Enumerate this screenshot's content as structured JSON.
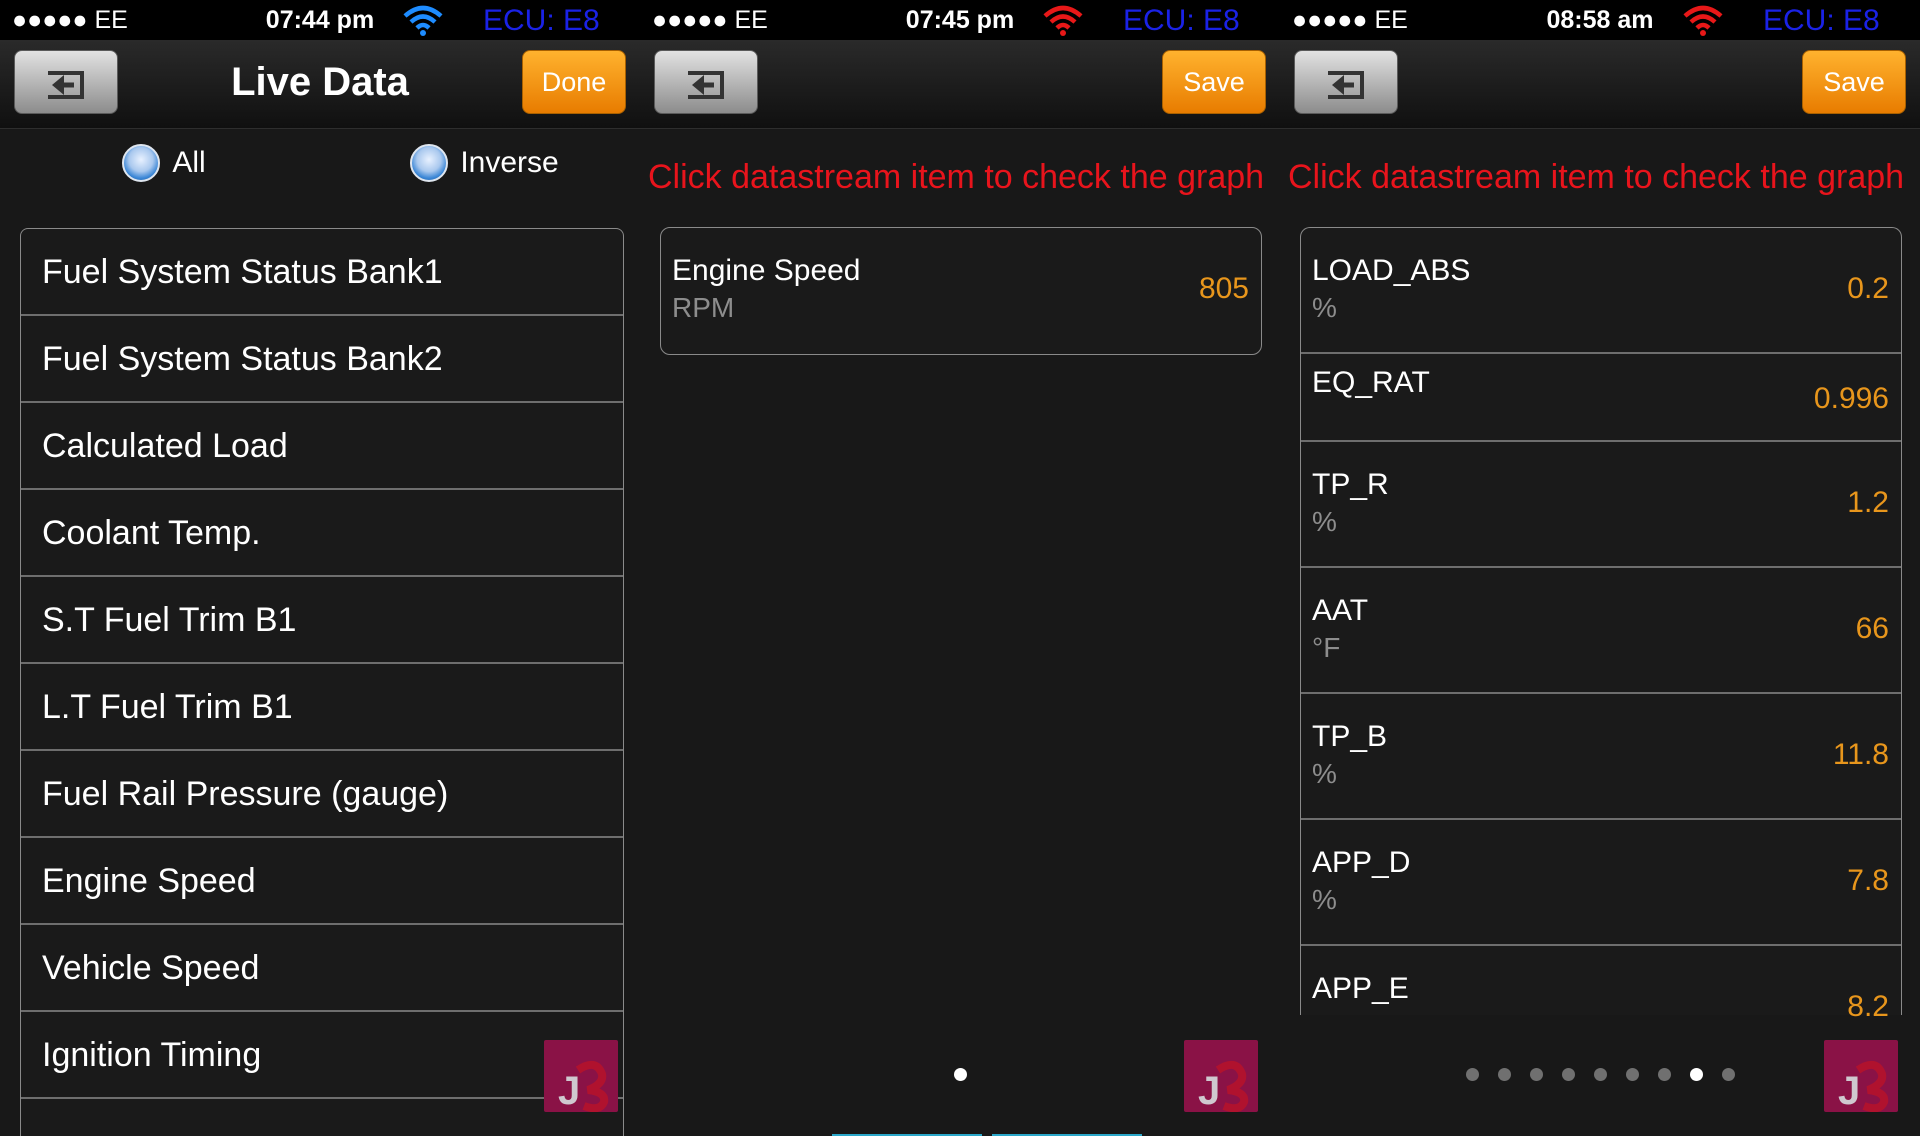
{
  "panels": [
    {
      "status": {
        "carrier": "●●●●● EE",
        "time": "07:44 pm",
        "ecu": "ECU: E8",
        "wifi_color": "#1e8cff"
      },
      "nav": {
        "title": "Live Data",
        "button": "Done"
      },
      "toggles": {
        "all": "All",
        "inverse": "Inverse"
      },
      "items": [
        "Fuel System Status Bank1",
        "Fuel System Status Bank2",
        "Calculated Load",
        "Coolant Temp.",
        "S.T Fuel Trim B1",
        "L.T Fuel Trim B1",
        "Fuel Rail Pressure (gauge)",
        "Engine Speed",
        "Vehicle Speed",
        "Ignition Timing"
      ]
    },
    {
      "status": {
        "carrier": "●●●●● EE",
        "time": "07:45 pm",
        "ecu": "ECU: E8",
        "wifi_color": "#e81818"
      },
      "nav": {
        "button": "Save"
      },
      "hint": "Click datastream item to check the graph",
      "rows": [
        {
          "name": "Engine Speed",
          "unit": "RPM",
          "value": "805"
        }
      ]
    },
    {
      "status": {
        "carrier": "●●●●● EE",
        "time": "08:58 am",
        "ecu": "ECU: E8",
        "wifi_color": "#e81818"
      },
      "nav": {
        "button": "Save"
      },
      "hint": "Click datastream item to check the graph",
      "rows": [
        {
          "name": "LOAD_ABS",
          "unit": "%",
          "value": "0.2"
        },
        {
          "name": "EQ_RAT",
          "unit": "",
          "value": "0.996"
        },
        {
          "name": "TP_R",
          "unit": "%",
          "value": "1.2"
        },
        {
          "name": "AAT",
          "unit": "°F",
          "value": "66"
        },
        {
          "name": "TP_B",
          "unit": "%",
          "value": "11.8"
        },
        {
          "name": "APP_D",
          "unit": "%",
          "value": "7.8"
        },
        {
          "name": "APP_E",
          "unit": "",
          "value": "8.2"
        }
      ],
      "page_dots": {
        "count": 9,
        "active": 8
      }
    }
  ],
  "colors": {
    "accent_orange": "#e8961c",
    "hint_red": "#e8141c",
    "ecu_blue": "#1a22e6",
    "logo": "#8a1246"
  }
}
